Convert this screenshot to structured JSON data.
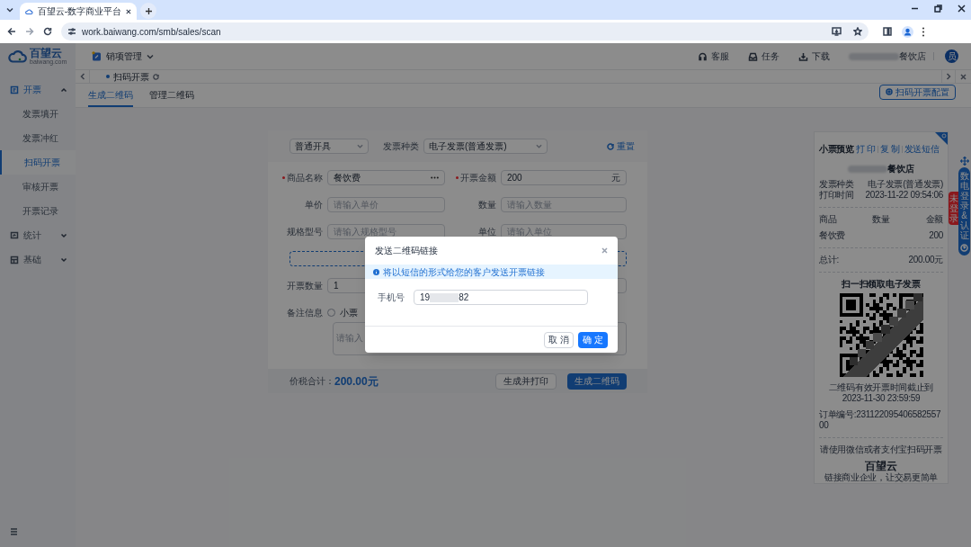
{
  "browser": {
    "tab_title": "百望云-数字商业平台",
    "url": "work.baiwang.com/smb/sales/scan"
  },
  "logo": {
    "name": "百望云",
    "sub": "baiwang.com"
  },
  "header": {
    "module": "销项管理",
    "actions": [
      {
        "label": "客服",
        "kind": "headset"
      },
      {
        "label": "任务",
        "kind": "inbox"
      },
      {
        "label": "下载",
        "kind": "download"
      }
    ],
    "store": "餐饮店",
    "avatar": "员"
  },
  "sidebar": [
    {
      "label": "开票",
      "kind": "invoice",
      "expanded": true,
      "children": [
        {
          "label": "发票填开",
          "selected": false
        },
        {
          "label": "发票冲红",
          "selected": false
        },
        {
          "label": "扫码开票",
          "selected": true
        },
        {
          "label": "审核开票",
          "selected": false
        },
        {
          "label": "开票记录",
          "selected": false
        }
      ]
    },
    {
      "label": "统计",
      "kind": "stats",
      "expanded": false
    },
    {
      "label": "基础",
      "kind": "base",
      "expanded": false
    }
  ],
  "page_tabs": [
    {
      "label": "扫码开票",
      "selected": true
    }
  ],
  "subtabs": [
    {
      "label": "生成二维码",
      "selected": true
    },
    {
      "label": "管理二维码",
      "selected": false
    }
  ],
  "config_button": "扫码开票配置",
  "form": {
    "mode_select": "普通开具",
    "type_label": "发票种类",
    "type_select": "电子发票(普通发票)",
    "reset": "重置",
    "fields": [
      {
        "label": "商品名称",
        "required": true,
        "value": "餐饮费",
        "kind": "picker"
      },
      {
        "label": "开票金额",
        "required": true,
        "value": "200",
        "unit": "元",
        "kind": "amount"
      },
      {
        "label": "单价",
        "required": false,
        "placeholder": "请输入单价",
        "kind": "text"
      },
      {
        "label": "数量",
        "required": false,
        "placeholder": "请输入数量",
        "kind": "text"
      },
      {
        "label": "规格型号",
        "required": false,
        "placeholder": "请输入规格型号",
        "kind": "text"
      },
      {
        "label": "单位",
        "required": false,
        "placeholder": "请输入单位",
        "kind": "text"
      }
    ],
    "count_label": "开票数量",
    "count_value": "1",
    "remark_label": "备注信息",
    "remark_option": {
      "label": "小票",
      "checked": false
    },
    "remark_placeholder": "请输入"
  },
  "footer": {
    "total_label": "价税合计：",
    "total": "200.00元",
    "buttons": [
      {
        "label": "生成并打印",
        "primary": false
      },
      {
        "label": "生成二维码",
        "primary": true
      }
    ]
  },
  "receipt": {
    "title": "小票预览",
    "links": [
      "打 印",
      "复 制",
      "发送短信"
    ],
    "store": "餐饮店",
    "info": [
      {
        "label": "发票种类",
        "value": "电子发票(普通发票)"
      },
      {
        "label": "打印时间",
        "value": "2023-11-22 09:54:06"
      }
    ],
    "columns": [
      "商品",
      "数量",
      "金额"
    ],
    "items": [
      {
        "name": "餐饮费",
        "amount": "200"
      }
    ],
    "total_label": "总计:",
    "total": "200.00元",
    "scan_title": "扫一扫领取电子发票",
    "expiry_label": "二维码有效开票时间截止到",
    "expiry": "2023-11-30 23:59:59",
    "order": "订单编号:23112209540658255700",
    "hint": "请使用微信或者支付宝扫码开票",
    "brand": "百望云",
    "slogan": "链接商业企业，让交易更简单"
  },
  "widget": {
    "label": "数电登录&认证",
    "badge": "未登录"
  },
  "modal": {
    "title": "发送二维码链接",
    "notice": "将以短信的形式给您的客户发送开票链接",
    "phone_label": "手机号",
    "phone_prefix": "19",
    "phone_suffix": "82",
    "cancel": "取 消",
    "ok": "确 定"
  }
}
